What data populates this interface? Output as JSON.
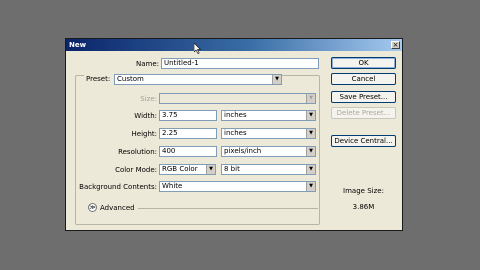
{
  "dialog": {
    "title": "New",
    "close_glyph": "×",
    "name": {
      "label": "Name:",
      "value": "Untitled-1"
    },
    "preset": {
      "label": "Preset:",
      "value": "Custom"
    },
    "size": {
      "label": "Size:",
      "value": ""
    },
    "width": {
      "label": "Width:",
      "value": "3.75",
      "unit": "inches"
    },
    "height": {
      "label": "Height:",
      "value": "2.25",
      "unit": "inches"
    },
    "resolution": {
      "label": "Resolution:",
      "value": "400",
      "unit": "pixels/inch"
    },
    "color_mode": {
      "label": "Color Mode:",
      "mode": "RGB Color",
      "depth": "8 bit"
    },
    "background": {
      "label": "Background Contents:",
      "value": "White"
    },
    "advanced": {
      "label": "Advanced",
      "toggle_glyph": "≫"
    },
    "buttons": {
      "ok": "OK",
      "cancel": "Cancel",
      "save_preset": "Save Preset...",
      "delete_preset": "Delete Preset...",
      "device_central": "Device Central..."
    },
    "image_size": {
      "label": "Image Size:",
      "value": "3.86M"
    }
  },
  "icons": {
    "dropdown_arrow": "▼",
    "mouse_cursor": "pointer-cursor-icon"
  }
}
